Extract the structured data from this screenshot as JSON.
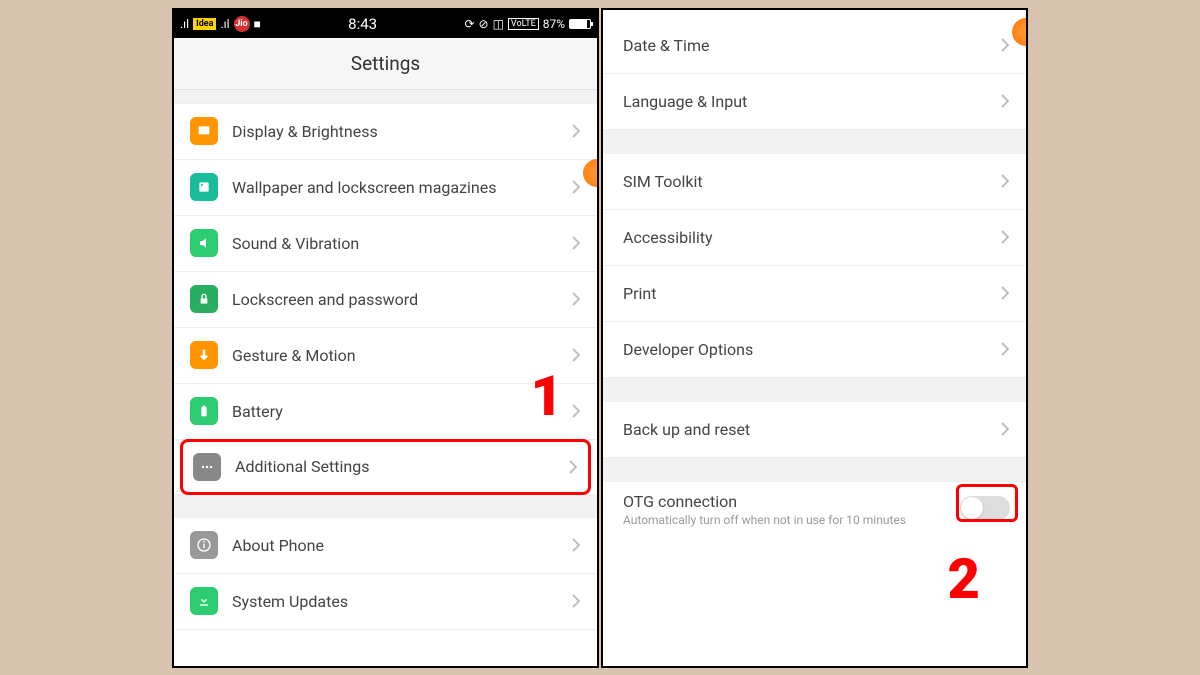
{
  "statusBar": {
    "carrier1": "Idea",
    "carrier2": "Jio",
    "time": "8:43",
    "volte": "VoLTE",
    "battery": "87%"
  },
  "header": "Settings",
  "phone1": {
    "items": [
      {
        "label": "Display & Brightness"
      },
      {
        "label": "Wallpaper and lockscreen magazines"
      },
      {
        "label": "Sound & Vibration"
      },
      {
        "label": "Lockscreen and password"
      },
      {
        "label": "Gesture & Motion"
      },
      {
        "label": "Battery"
      },
      {
        "label": "Additional Settings"
      },
      {
        "label": "About Phone"
      },
      {
        "label": "System Updates"
      }
    ]
  },
  "phone2": {
    "items": [
      {
        "label": "Date & Time"
      },
      {
        "label": "Language & Input"
      },
      {
        "label": "SIM Toolkit"
      },
      {
        "label": "Accessibility"
      },
      {
        "label": "Print"
      },
      {
        "label": "Developer Options"
      },
      {
        "label": "Back up and reset"
      }
    ],
    "otg": {
      "title": "OTG connection",
      "subtitle": "Automatically turn off when not in use for 10 minutes"
    }
  },
  "annotations": {
    "one": "1",
    "two": "2"
  }
}
